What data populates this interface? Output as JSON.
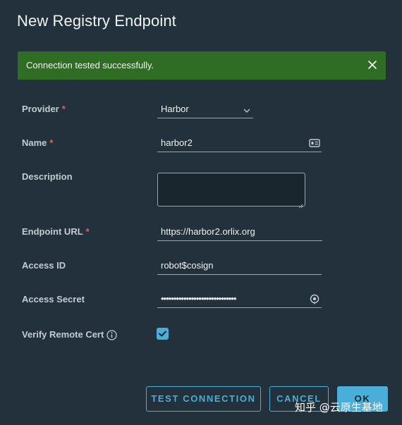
{
  "dialog": {
    "title": "New Registry Endpoint"
  },
  "alert": {
    "message": "Connection tested successfully.",
    "close_icon": "close-icon"
  },
  "form": {
    "provider": {
      "label": "Provider",
      "required_mark": "*",
      "value": "Harbor"
    },
    "name": {
      "label": "Name",
      "required_mark": "*",
      "value": "harbor2",
      "icon": "id-card-icon"
    },
    "description": {
      "label": "Description",
      "value": ""
    },
    "endpoint_url": {
      "label": "Endpoint URL",
      "required_mark": "*",
      "value": "https://harbor2.orlix.org"
    },
    "access_id": {
      "label": "Access ID",
      "value": "robot$cosign"
    },
    "access_secret": {
      "label": "Access Secret",
      "value": "••••••••••••••••••••••••••••••",
      "icon": "eye-icon"
    },
    "verify_remote_cert": {
      "label": "Verify Remote Cert",
      "checked": true,
      "icon": "info-icon"
    }
  },
  "buttons": {
    "test_connection": "TEST CONNECTION",
    "cancel": "CANCEL",
    "ok": "OK"
  },
  "watermark": "知乎 @云原生基地",
  "colors": {
    "background": "#22313b",
    "alert_success": "#2f6c24",
    "accent": "#49afd9",
    "required": "#e2634f"
  }
}
